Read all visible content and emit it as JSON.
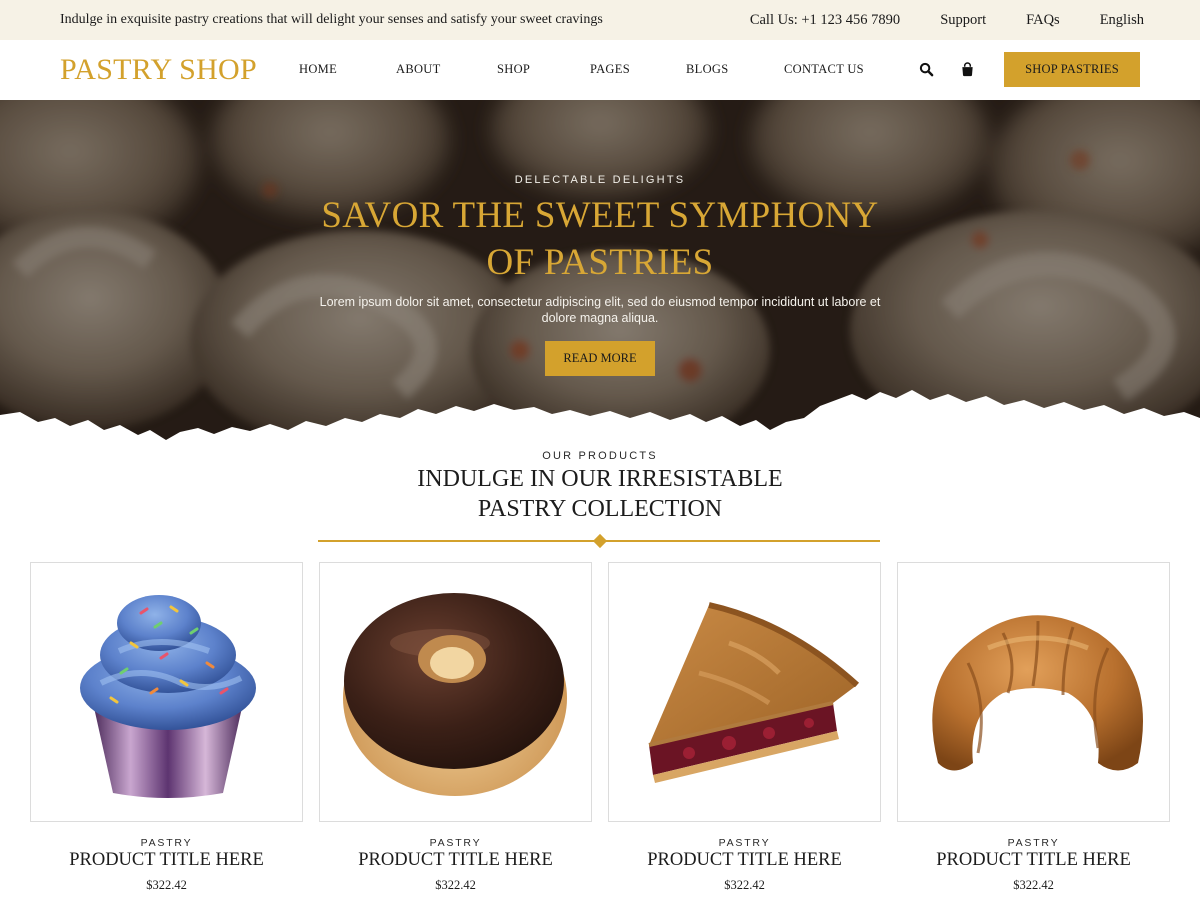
{
  "topbar": {
    "tagline": "Indulge in exquisite pastry creations that will delight your senses and satisfy your sweet cravings",
    "phone": "Call Us: +1 123 456 7890",
    "support": "Support",
    "faqs": "FAQs",
    "language": "English"
  },
  "header": {
    "logo": "PASTRY SHOP",
    "nav": [
      "HOME",
      "ABOUT",
      "SHOP",
      "PAGES",
      "BLOGS",
      "CONTACT US"
    ],
    "icons": [
      "search-icon",
      "shopping-bag-icon"
    ],
    "cta": "SHOP PASTRIES"
  },
  "hero": {
    "eyebrow": "DELECTABLE DELIGHTS",
    "title": "SAVOR THE SWEET SYMPHONY OF PASTRIES",
    "description": "Lorem ipsum dolor sit amet, consectetur adipiscing elit, sed do eiusmod tempor incididunt ut labore et dolore magna aliqua.",
    "button": "READ MORE"
  },
  "products_section": {
    "eyebrow": "OUR PRODUCTS",
    "title": "INDULGE IN OUR IRRESISTABLE PASTRY COLLECTION",
    "products": [
      {
        "category": "PASTRY",
        "title": "PRODUCT TITLE HERE",
        "price": "$322.42",
        "image": "cupcake"
      },
      {
        "category": "PASTRY",
        "title": "PRODUCT TITLE HERE",
        "price": "$322.42",
        "image": "donut"
      },
      {
        "category": "PASTRY",
        "title": "PRODUCT TITLE HERE",
        "price": "$322.42",
        "image": "pie-slice"
      },
      {
        "category": "PASTRY",
        "title": "PRODUCT TITLE HERE",
        "price": "$322.42",
        "image": "croissant"
      }
    ]
  },
  "colors": {
    "accent": "#d3a12c",
    "topbar_bg": "#f6f2e6",
    "text": "#1c1c1c"
  }
}
